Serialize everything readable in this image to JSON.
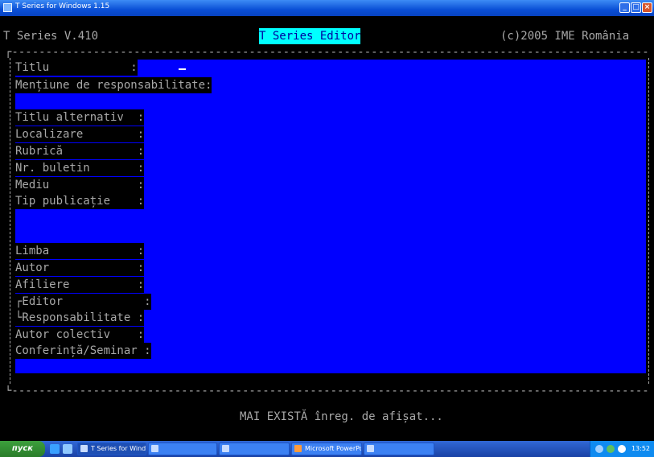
{
  "window": {
    "title": "T Series for Windows 1.15"
  },
  "header": {
    "product": "T Series V.410",
    "editor_title": "T Series Editor",
    "copyright": "(c)2005 IME România"
  },
  "form": {
    "title_field": "Titlu            :",
    "responsibility_field": "Mențiune de responsabilitate:",
    "fields_group1": [
      "Titlu alternativ  :",
      "Localizare        :",
      "Rubrică           :",
      "Nr. buletin       :",
      "Mediu             :",
      "Tip publicație    :"
    ],
    "fields_group2": [
      "Limba             :",
      "Autor             :",
      "Afiliere          :",
      "┌Editor            :",
      "└Responsabilitate :",
      "Autor colectiv    :",
      "Conferință/Seminar :"
    ]
  },
  "status_message": "MAI EXISTĂ înreg. de afișat...",
  "taskbar": {
    "start_label": "пуск",
    "tasks": [
      {
        "label": "T Series for Windows ...",
        "active": true
      },
      {
        "label": "",
        "active": false
      },
      {
        "label": "",
        "active": false
      },
      {
        "label": "Microsoft PowerPoint ...",
        "active": false
      },
      {
        "label": "",
        "active": false
      }
    ],
    "clock": "13:52"
  },
  "colors": {
    "field_background": "#0000ff",
    "title_highlight": "#00ffff",
    "console_text": "#a8a8a8",
    "titlebar": "#0a4fd6"
  },
  "icons": {
    "window": "app-icon",
    "minimize": "minimize-icon",
    "maximize": "maximize-icon",
    "close": "close-icon"
  }
}
